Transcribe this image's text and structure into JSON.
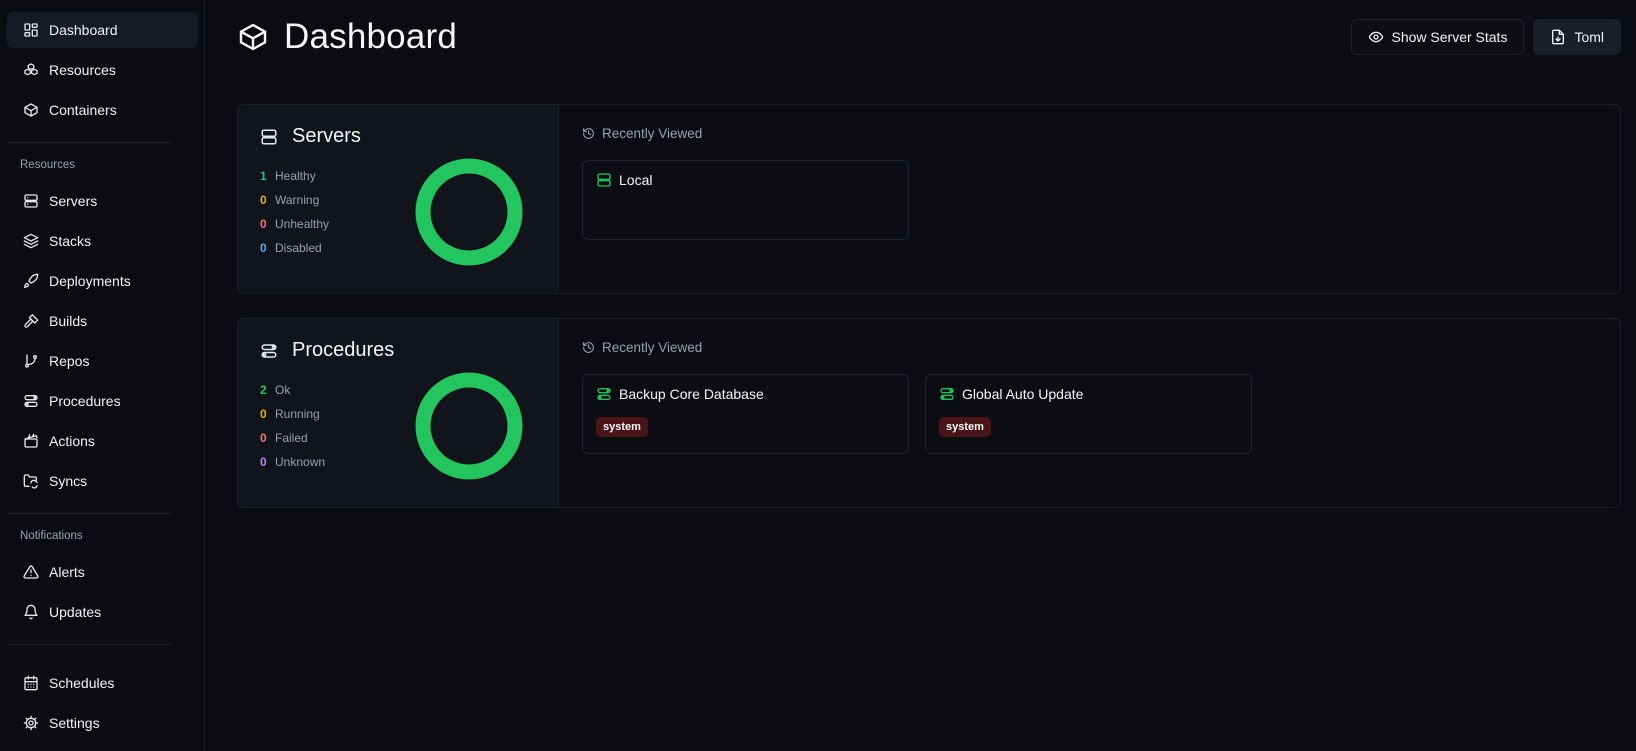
{
  "colors": {
    "accent_green": "#22c55e",
    "yellow": "#eab308",
    "red": "#f87171",
    "blue": "#60a5fa",
    "purple": "#c084fc",
    "tag_bg": "#4a1518"
  },
  "sidebar": {
    "top_items": [
      {
        "label": "Dashboard",
        "icon": "dashboard-icon",
        "active": true
      },
      {
        "label": "Resources",
        "icon": "boxes-icon"
      },
      {
        "label": "Containers",
        "icon": "box-icon"
      }
    ],
    "resources_section": "Resources",
    "resource_items": [
      {
        "label": "Servers",
        "icon": "server-icon"
      },
      {
        "label": "Stacks",
        "icon": "layers-icon"
      },
      {
        "label": "Deployments",
        "icon": "rocket-icon"
      },
      {
        "label": "Builds",
        "icon": "hammer-icon"
      },
      {
        "label": "Repos",
        "icon": "git-branch-icon"
      },
      {
        "label": "Procedures",
        "icon": "route-icon"
      },
      {
        "label": "Actions",
        "icon": "clapperboard-icon"
      },
      {
        "label": "Syncs",
        "icon": "folder-sync-icon"
      }
    ],
    "notifications_section": "Notifications",
    "notification_items": [
      {
        "label": "Alerts",
        "icon": "alert-triangle-icon"
      },
      {
        "label": "Updates",
        "icon": "bell-icon"
      }
    ],
    "bottom_items": [
      {
        "label": "Schedules",
        "icon": "calendar-icon"
      },
      {
        "label": "Settings",
        "icon": "gear-icon"
      }
    ]
  },
  "header": {
    "title": "Dashboard",
    "show_stats_label": "Show Server Stats",
    "toml_label": "Toml"
  },
  "servers": {
    "title": "Servers",
    "stats": [
      {
        "count": "1",
        "label": "Healthy",
        "color": "#22c55e"
      },
      {
        "count": "0",
        "label": "Warning",
        "color": "#eab308"
      },
      {
        "count": "0",
        "label": "Unhealthy",
        "color": "#f87171"
      },
      {
        "count": "0",
        "label": "Disabled",
        "color": "#60a5fa"
      }
    ],
    "recent_title": "Recently Viewed",
    "recent": [
      {
        "name": "Local"
      }
    ]
  },
  "procedures": {
    "title": "Procedures",
    "stats": [
      {
        "count": "2",
        "label": "Ok",
        "color": "#22c55e"
      },
      {
        "count": "0",
        "label": "Running",
        "color": "#eab308"
      },
      {
        "count": "0",
        "label": "Failed",
        "color": "#f87171"
      },
      {
        "count": "0",
        "label": "Unknown",
        "color": "#c084fc"
      }
    ],
    "recent_title": "Recently Viewed",
    "recent": [
      {
        "name": "Backup Core Database",
        "tag": "system"
      },
      {
        "name": "Global Auto Update",
        "tag": "system"
      }
    ]
  }
}
